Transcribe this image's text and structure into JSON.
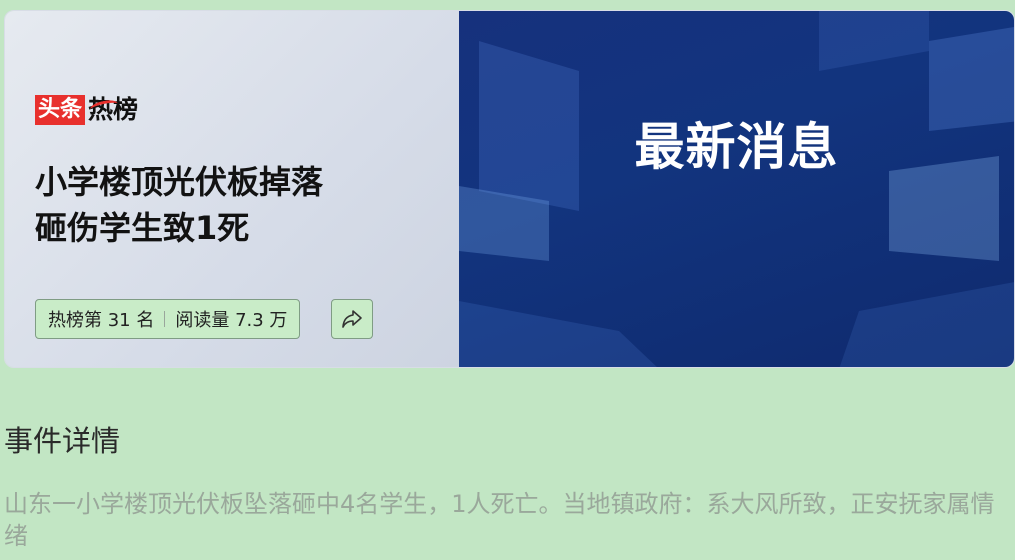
{
  "card": {
    "brand_box": "头条",
    "brand_hot": "热榜",
    "headline_line1": "小学楼顶光伏板掉落",
    "headline_line2": "砸伤学生致1死",
    "rank_text": "热榜第 31 名",
    "reads_text": "阅读量 7.3 万",
    "share_icon": "share-icon",
    "image_title": "最新消息"
  },
  "details": {
    "section_title": "事件详情",
    "description": "山东一小学楼顶光伏板坠落砸中4名学生，1人死亡。当地镇政府：系大风所致，正安抚家属情绪"
  },
  "colors": {
    "page_bg": "#c2e6c4",
    "brand_red": "#e8302d",
    "image_blue": "#12347e",
    "muted_text": "#9aa89b"
  }
}
